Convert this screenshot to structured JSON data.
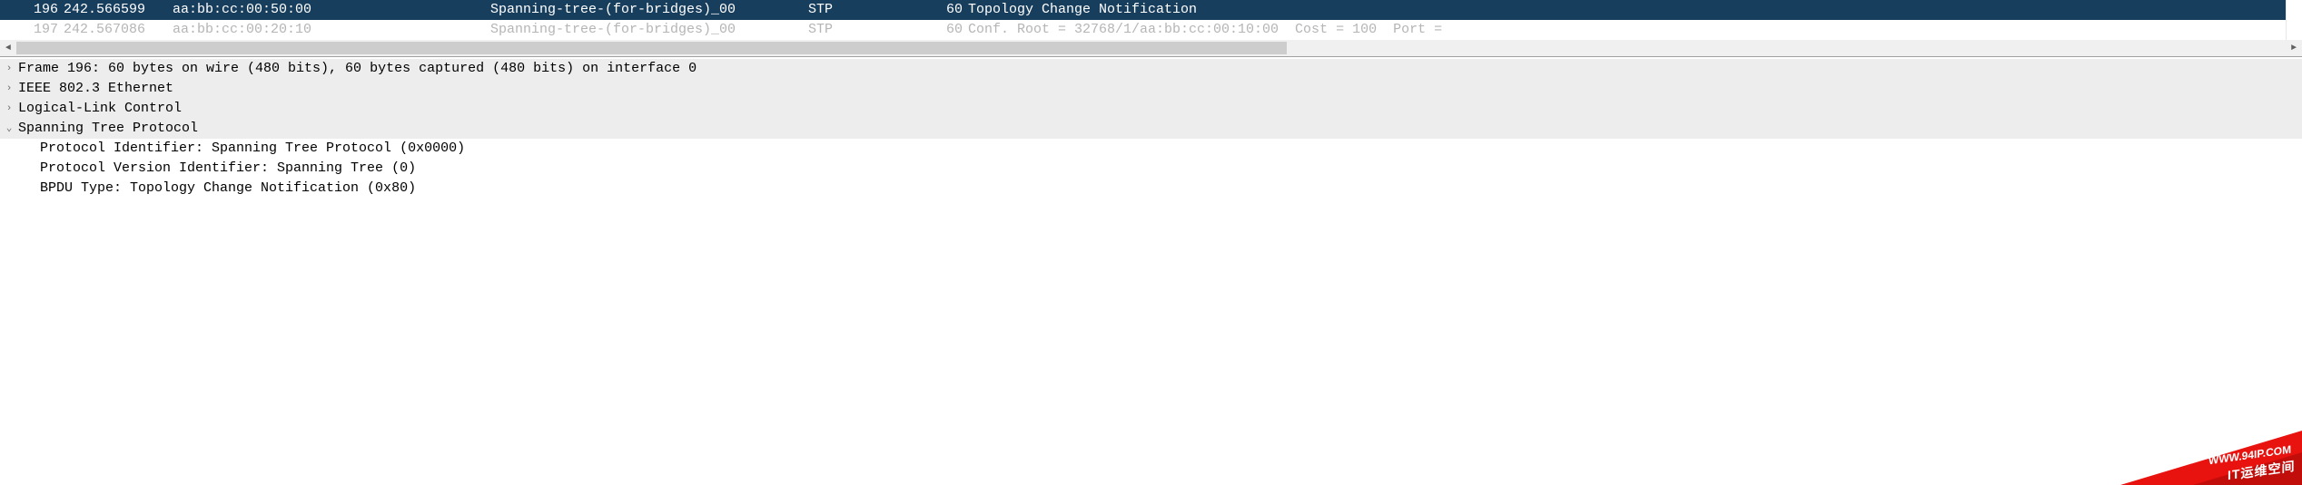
{
  "packet_list": {
    "rows": [
      {
        "selected": true,
        "dimmed": false,
        "no": "196",
        "time": "242.566599",
        "source": "aa:bb:cc:00:50:00",
        "destination": "Spanning-tree-(for-bridges)_00",
        "protocol": "STP",
        "length": "60",
        "info": "Topology Change Notification"
      },
      {
        "selected": false,
        "dimmed": true,
        "no": "197",
        "time": "242.567086",
        "source": "aa:bb:cc:00:20:10",
        "destination": "Spanning-tree-(for-bridges)_00",
        "protocol": "STP",
        "length": "60",
        "info": "Conf. Root = 32768/1/aa:bb:cc:00:10:00  Cost = 100  Port ="
      }
    ]
  },
  "scroll": {
    "left_arrow": "◄",
    "right_arrow": "►"
  },
  "details": {
    "top": [
      {
        "expanded": false,
        "label": "Frame 196: 60 bytes on wire (480 bits), 60 bytes captured (480 bits) on interface 0"
      },
      {
        "expanded": false,
        "label": "IEEE 802.3 Ethernet"
      },
      {
        "expanded": false,
        "label": "Logical-Link Control"
      },
      {
        "expanded": true,
        "label": "Spanning Tree Protocol"
      }
    ],
    "children": [
      "Protocol Identifier: Spanning Tree Protocol (0x0000)",
      "Protocol Version Identifier: Spanning Tree (0)",
      "BPDU Type: Topology Change Notification (0x80)"
    ]
  },
  "twisty": {
    "collapsed": "›",
    "expanded": "⌄"
  },
  "watermark": {
    "line1": "WWW.94IP.COM",
    "line2": "IT运维空间"
  }
}
